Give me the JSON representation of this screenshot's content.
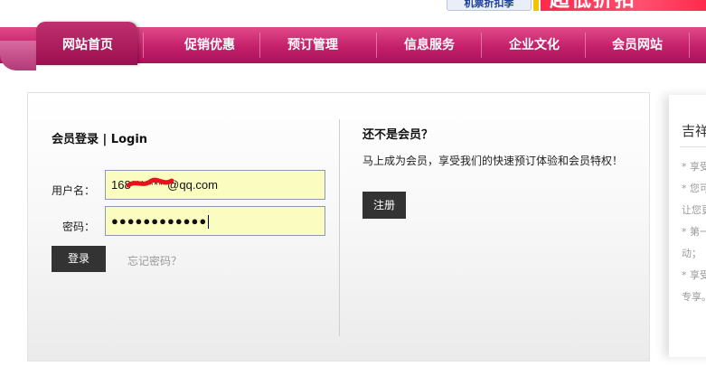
{
  "banner": {
    "promo_label": "机票折扣季",
    "promo_big": "超低折扣"
  },
  "nav": {
    "items": [
      {
        "label": "网站首页",
        "active": true
      },
      {
        "label": "促销优惠",
        "active": false
      },
      {
        "label": "预订管理",
        "active": false
      },
      {
        "label": "信息服务",
        "active": false
      },
      {
        "label": "企业文化",
        "active": false
      },
      {
        "label": "会员网站",
        "active": false
      }
    ]
  },
  "login": {
    "title": "会员登录 | Login",
    "username_label": "用户名：",
    "username_value": "168********@qq.com",
    "password_label": "密码：",
    "password_value": "●●●●●●●●●●●●",
    "submit_label": "登录",
    "forgot_label": "忘记密码？"
  },
  "register": {
    "title": "还不是会员？",
    "description": "马上成为会员，享受我们的快速预订体验和会员特权！",
    "button_label": "注册"
  },
  "side": {
    "title": "吉祥",
    "lines": [
      "* 享受",
      "* 您可",
      "让您更",
      "* 第一",
      "动；",
      "* 享受",
      "专享。"
    ]
  },
  "colors": {
    "nav_bg": "#c4206a",
    "nav_active": "#9c0f50",
    "input_bg": "#fafcc0",
    "button_bg": "#333333"
  }
}
